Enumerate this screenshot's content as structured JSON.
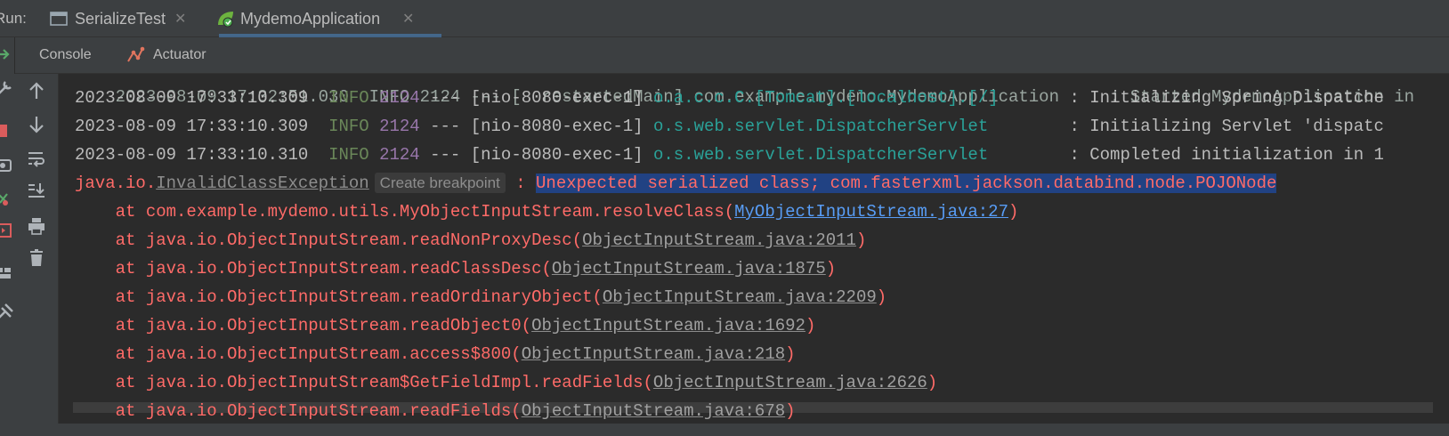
{
  "runbar": {
    "label": "Run:",
    "tabs": [
      {
        "label": "SerializeTest",
        "close": "✕"
      },
      {
        "label": "MydemoApplication",
        "close": "✕"
      }
    ]
  },
  "subtabs": {
    "console": "Console",
    "actuator": "Actuator"
  },
  "console": {
    "clipped_top": "2023-08-09 17:32:51.030  INFO 2124 --- [  restartedMain] com.example.mydemo.MydemoApplication     : Started MydemoApplication in",
    "log_lines": [
      {
        "ts": "2023-08-09 17:33:10.309",
        "level": "INFO",
        "pid": "2124",
        "sep": "---",
        "thread": "[nio-8080-exec-1]",
        "logger": "o.a.c.c.C.[Tomcat].[localhost].[/]",
        "msg": ": Initializing Spring Dispatche"
      },
      {
        "ts": "2023-08-09 17:33:10.309",
        "level": "INFO",
        "pid": "2124",
        "sep": "---",
        "thread": "[nio-8080-exec-1]",
        "logger": "o.s.web.servlet.DispatcherServlet",
        "msg": ": Initializing Servlet 'dispatc"
      },
      {
        "ts": "2023-08-09 17:33:10.310",
        "level": "INFO",
        "pid": "2124",
        "sep": "---",
        "thread": "[nio-8080-exec-1]",
        "logger": "o.s.web.servlet.DispatcherServlet",
        "msg": ": Completed initialization in 1"
      }
    ],
    "exception": {
      "prefix": "java.io.",
      "name": "InvalidClassException",
      "breakpoint_hint": "Create breakpoint",
      "colon": " : ",
      "message": "Unexpected serialized class; com.fasterxml.jackson.databind.node.POJONode"
    },
    "stack": [
      {
        "method": "at com.example.mydemo.utils.MyObjectInputStream.resolveClass(",
        "link": "MyObjectInputStream.java:27",
        "close": ")",
        "link_style": "blue"
      },
      {
        "method": "at java.io.ObjectInputStream.readNonProxyDesc(",
        "link": "ObjectInputStream.java:2011",
        "close": ")",
        "link_style": "gray"
      },
      {
        "method": "at java.io.ObjectInputStream.readClassDesc(",
        "link": "ObjectInputStream.java:1875",
        "close": ")",
        "link_style": "gray"
      },
      {
        "method": "at java.io.ObjectInputStream.readOrdinaryObject(",
        "link": "ObjectInputStream.java:2209",
        "close": ")",
        "link_style": "gray"
      },
      {
        "method": "at java.io.ObjectInputStream.readObject0(",
        "link": "ObjectInputStream.java:1692",
        "close": ")",
        "link_style": "gray"
      },
      {
        "method": "at java.io.ObjectInputStream.access$800(",
        "link": "ObjectInputStream.java:218",
        "close": ")",
        "link_style": "gray"
      },
      {
        "method": "at java.io.ObjectInputStream$GetFieldImpl.readFields(",
        "link": "ObjectInputStream.java:2626",
        "close": ")",
        "link_style": "gray"
      },
      {
        "method": "at java.io.ObjectInputStream.readFields(",
        "link": "ObjectInputStream.java:678",
        "close": ")",
        "link_style": "gray"
      }
    ]
  },
  "colors": {
    "background": "#2b2b2b",
    "panel": "#3c3f41",
    "info": "#6a8759",
    "pid": "#9876aa",
    "logger": "#2aa198",
    "error": "#ff6b68",
    "selection": "#214283",
    "link_blue": "#589df6"
  }
}
